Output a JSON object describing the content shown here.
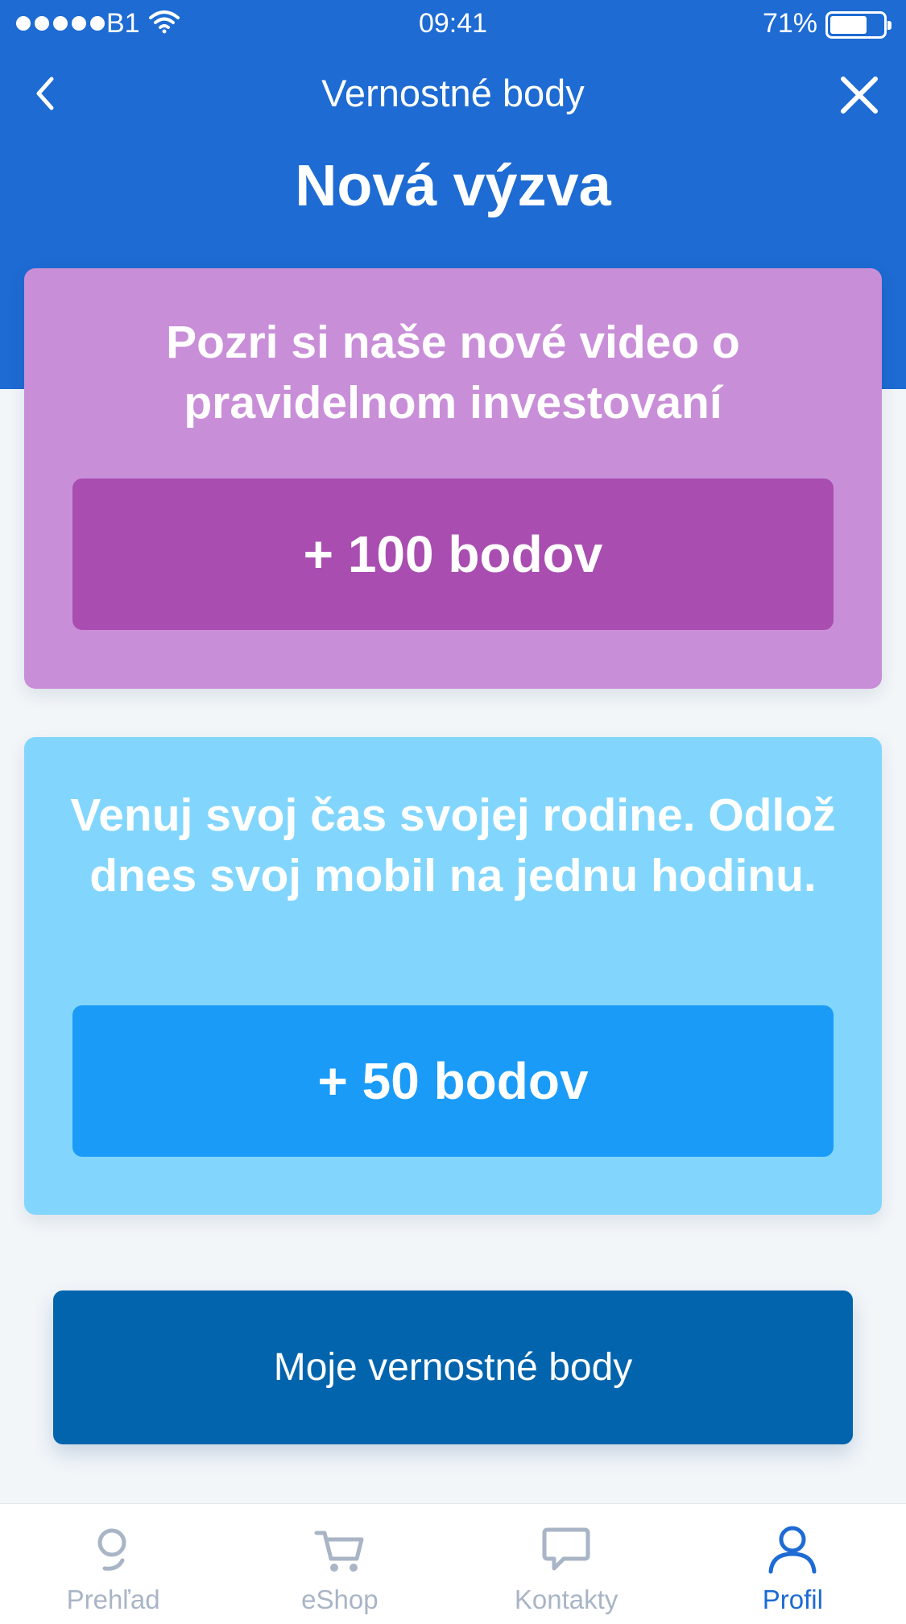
{
  "status_bar": {
    "carrier": "B1",
    "time": "09:41",
    "battery": "71%",
    "battery_level": 0.71
  },
  "nav": {
    "title": "Vernostné body"
  },
  "page": {
    "title": "Nová výzva"
  },
  "challenges": [
    {
      "text": "Pozri si naše nové video o pravidelnom investovaní",
      "points_label": "+ 100 bodov",
      "card_color": "#c98ed8",
      "button_color": "#a94db1"
    },
    {
      "text": "Venuj svoj čas svojej rodine. Odlož dnes svoj mobil na jednu hodinu.",
      "points_label": "+ 50 bodov",
      "card_color": "#82d6fd",
      "button_color": "#1a9bf8"
    }
  ],
  "primary_button": {
    "label": "Moje vernostné body"
  },
  "tabs": [
    {
      "label": "Prehľad",
      "icon": "overview-icon",
      "active": false
    },
    {
      "label": "eShop",
      "icon": "cart-icon",
      "active": false
    },
    {
      "label": "Kontakty",
      "icon": "chat-icon",
      "active": false
    },
    {
      "label": "Profil",
      "icon": "profile-icon",
      "active": true
    }
  ],
  "colors": {
    "brand_blue": "#1d6bd3",
    "primary_button": "#0164ad",
    "tab_inactive": "#a9b5c6",
    "tab_active": "#1d6bd3"
  }
}
